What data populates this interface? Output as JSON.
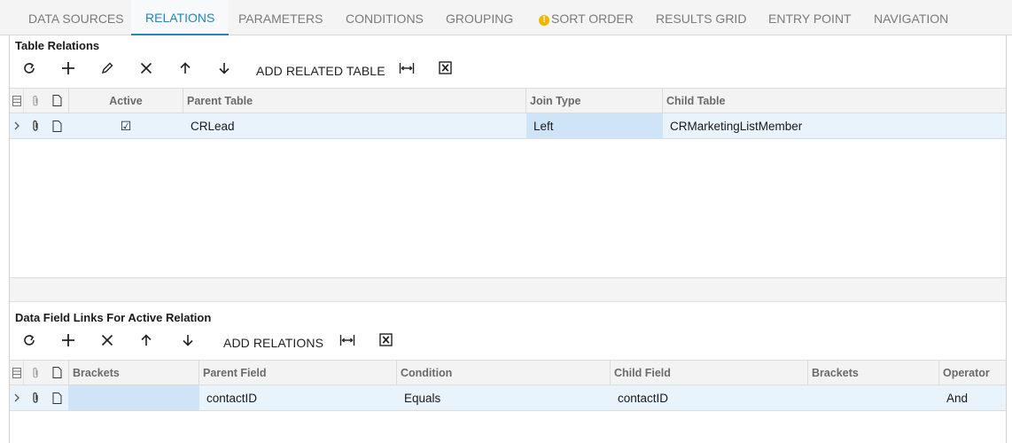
{
  "tabs": [
    {
      "label": "DATA SOURCES"
    },
    {
      "label": "RELATIONS"
    },
    {
      "label": "PARAMETERS"
    },
    {
      "label": "CONDITIONS"
    },
    {
      "label": "GROUPING"
    },
    {
      "label": "SORT ORDER"
    },
    {
      "label": "RESULTS GRID"
    },
    {
      "label": "ENTRY POINT"
    },
    {
      "label": "NAVIGATION"
    }
  ],
  "active_tab": "RELATIONS",
  "warning_tab": "SORT ORDER",
  "table_relations": {
    "title": "Table Relations",
    "toolbar": {
      "refresh_icon": "refresh-icon",
      "add_icon": "plus-icon",
      "edit_icon": "pencil-icon",
      "delete_icon": "close-icon",
      "up_icon": "arrow-up-icon",
      "down_icon": "arrow-down-icon",
      "add_related_table_label": "ADD RELATED TABLE",
      "fit_icon": "fit-columns-icon",
      "excel_icon": "excel-export-icon"
    },
    "columns": [
      "Active",
      "Parent Table",
      "Join Type",
      "Child Table"
    ],
    "rows": [
      {
        "active": "☑",
        "parent_table": "CRLead",
        "join_type": "Left",
        "child_table": "CRMarketingListMember"
      }
    ]
  },
  "data_field_links": {
    "title": "Data Field Links For Active Relation",
    "toolbar": {
      "refresh_icon": "refresh-icon",
      "add_icon": "plus-icon",
      "delete_icon": "close-icon",
      "up_icon": "arrow-up-icon",
      "down_icon": "arrow-down-icon",
      "add_relations_label": "ADD RELATIONS",
      "fit_icon": "fit-columns-icon",
      "excel_icon": "excel-export-icon"
    },
    "columns": [
      "Brackets",
      "Parent Field",
      "Condition",
      "Child Field",
      "Brackets",
      "Operator"
    ],
    "rows": [
      {
        "brackets_open": "",
        "parent_field": "contactID",
        "condition": "Equals",
        "child_field": "contactID",
        "brackets_close": "",
        "operator": "And"
      }
    ]
  },
  "colors": {
    "accent": "#1b88c6",
    "selected_row": "#e8f3fb",
    "selected_cell": "#cfe5f7",
    "warning": "#f2b500"
  }
}
